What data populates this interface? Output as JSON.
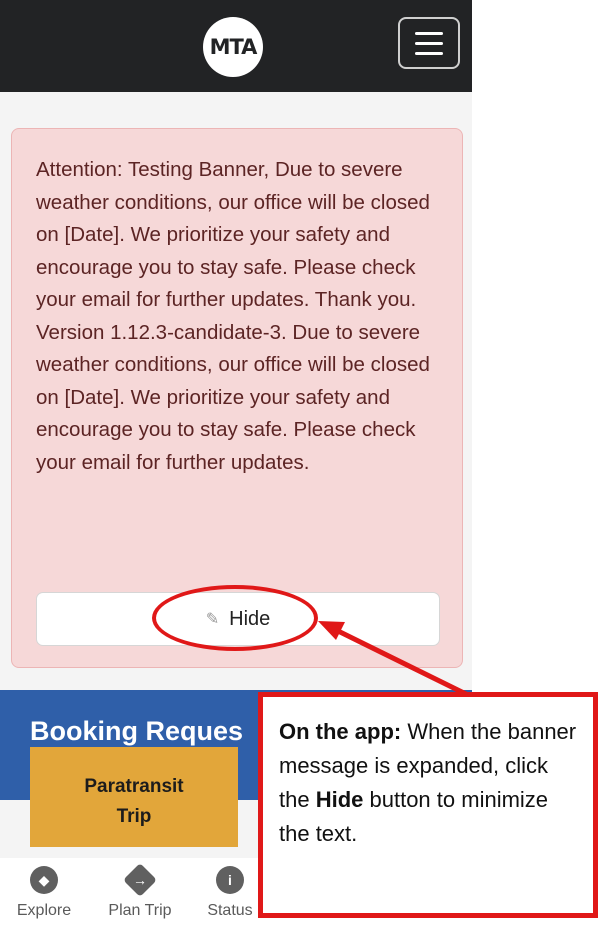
{
  "header": {
    "logo_text": "MTA",
    "menu_icon": "hamburger-icon"
  },
  "alert": {
    "message": "Attention: Testing Banner, Due to severe weather conditions, our office will be closed on [Date]. We prioritize your safety and encourage you to stay safe. Please check your email for further updates. Thank you. Version 1.12.3-candidate-3. Due to severe weather conditions, our office will be closed on [Date]. We prioritize your safety and encourage you to stay safe. Please check your email for further updates.",
    "hide_label": "Hide",
    "hide_icon": "edit-icon"
  },
  "booking": {
    "title": "Booking Reques",
    "card_line1": "Paratransit",
    "card_line2": "Trip"
  },
  "bottom_nav": {
    "items": [
      {
        "label": "Explore",
        "icon": "compass-icon"
      },
      {
        "label": "Plan Trip",
        "icon": "directions-icon"
      },
      {
        "label": "Status",
        "icon": "info-icon"
      }
    ]
  },
  "annotation": {
    "lead": "On the app:",
    "part1": " When the banner message is expanded, click the ",
    "bold_word": "Hide",
    "part2": " button to minimize the text."
  },
  "colors": {
    "topbar": "#222325",
    "alert_bg": "#f6d8d8",
    "booking_header": "#2f5fa9",
    "card": "#e2a63a",
    "annotation_red": "#e01818"
  }
}
